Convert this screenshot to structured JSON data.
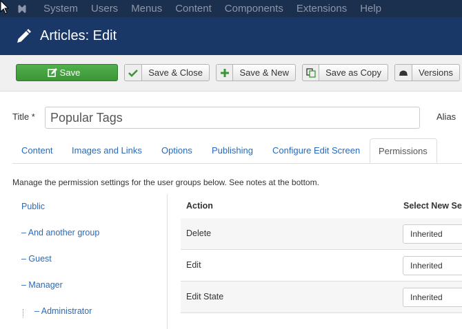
{
  "topnav": {
    "items": [
      "System",
      "Users",
      "Menus",
      "Content",
      "Components",
      "Extensions",
      "Help"
    ]
  },
  "header": {
    "title": "Articles: Edit"
  },
  "toolbar": {
    "save": "Save",
    "save_close": "Save & Close",
    "save_new": "Save & New",
    "save_copy": "Save as Copy",
    "versions": "Versions"
  },
  "form": {
    "title_label": "Title *",
    "title_value": "Popular Tags",
    "alias_label": "Alias"
  },
  "tabs": [
    "Content",
    "Images and Links",
    "Options",
    "Publishing",
    "Configure Edit Screen",
    "Permissions"
  ],
  "active_tab": "Permissions",
  "permissions": {
    "note": "Manage the permission settings for the user groups below. See notes at the bottom.",
    "groups": [
      "Public",
      "– And another group",
      "– Guest",
      "– Manager",
      "– Administrator"
    ],
    "col_action": "Action",
    "col_setting": "Select New Se",
    "rows": [
      {
        "action": "Delete",
        "value": "Inherited"
      },
      {
        "action": "Edit",
        "value": "Inherited"
      },
      {
        "action": "Edit State",
        "value": "Inherited"
      }
    ]
  },
  "colors": {
    "topnav_bg": "#1b2f4e",
    "header_bg": "#1a3867",
    "save_green": "#46a546",
    "link_blue": "#2a69b8"
  }
}
